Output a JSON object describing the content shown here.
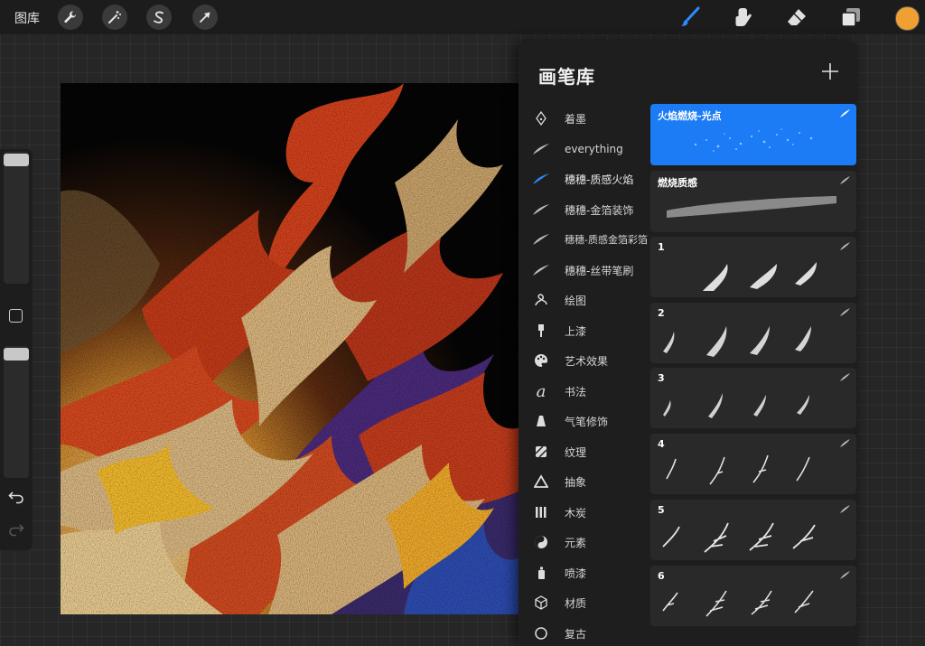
{
  "topbar": {
    "gallery_label": "图库",
    "left_tools": [
      {
        "name": "actions",
        "icon": "wrench-icon"
      },
      {
        "name": "adjustments",
        "icon": "magic-wand-icon"
      },
      {
        "name": "selection",
        "icon": "selection-s-icon"
      },
      {
        "name": "transform",
        "icon": "arrow-cursor-icon"
      }
    ],
    "right_tools": [
      {
        "name": "brush",
        "icon": "paintbrush-icon",
        "active": true
      },
      {
        "name": "smudge",
        "icon": "smudge-finger-icon",
        "active": false
      },
      {
        "name": "eraser",
        "icon": "eraser-icon",
        "active": false
      },
      {
        "name": "layers",
        "icon": "layers-icon",
        "active": false
      }
    ],
    "current_color": "#f0a033",
    "accent": "#2b8bff"
  },
  "sidebar": {
    "brush_size_icon": "size-slider-icon",
    "opacity_icon": "opacity-slider-icon",
    "modify_icon": "square-modify-icon",
    "undo_icon": "undo-arrow-icon",
    "redo_icon": "redo-arrow-icon"
  },
  "brush_library": {
    "title": "画笔库",
    "add_icon": "plus-icon",
    "categories": [
      {
        "label": "着墨",
        "icon": "inking-nib-icon"
      },
      {
        "label": "everything",
        "icon": "stroke-swoosh-icon"
      },
      {
        "label": "穗穗-质感火焰",
        "icon": "stroke-swoosh-icon",
        "selected": true
      },
      {
        "label": "穗穗-金箔装饰",
        "icon": "stroke-swoosh-icon"
      },
      {
        "label": "穗穗-质感金箔彩箔",
        "icon": "stroke-swoosh-icon"
      },
      {
        "label": "穗穗-丝带笔刷",
        "icon": "stroke-swoosh-icon"
      },
      {
        "label": "绘图",
        "icon": "drawing-loop-icon"
      },
      {
        "label": "上漆",
        "icon": "paint-brush-icon"
      },
      {
        "label": "艺术效果",
        "icon": "palette-icon"
      },
      {
        "label": "书法",
        "icon": "calligraphy-a-icon"
      },
      {
        "label": "气笔修饰",
        "icon": "airbrush-icon"
      },
      {
        "label": "纹理",
        "icon": "texture-hatch-icon"
      },
      {
        "label": "抽象",
        "icon": "triangle-icon"
      },
      {
        "label": "木炭",
        "icon": "charcoal-bars-icon"
      },
      {
        "label": "元素",
        "icon": "yin-yang-icon"
      },
      {
        "label": "喷漆",
        "icon": "spray-can-icon"
      },
      {
        "label": "材质",
        "icon": "cube-icon"
      },
      {
        "label": "复古",
        "icon": "retro-icon"
      }
    ],
    "brushes": [
      {
        "name": "火焰燃烧-光点",
        "selected": true
      },
      {
        "name": "燃烧质感",
        "selected": false
      },
      {
        "name": "1",
        "selected": false
      },
      {
        "name": "2",
        "selected": false
      },
      {
        "name": "3",
        "selected": false
      },
      {
        "name": "4",
        "selected": false
      },
      {
        "name": "5",
        "selected": false
      },
      {
        "name": "6",
        "selected": false
      }
    ]
  }
}
